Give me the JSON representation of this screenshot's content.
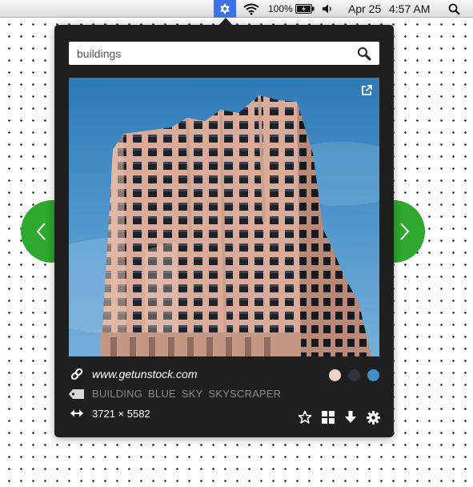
{
  "menubar": {
    "app_icon": "snowflake-gear-icon",
    "wifi_icon": "wifi-icon",
    "battery_percent": "100%",
    "battery_icon": "battery-charging-icon",
    "volume_icon": "speaker-icon",
    "date": "Apr 25",
    "time": "4:57 AM",
    "spotlight_icon": "search-icon"
  },
  "search": {
    "value": "buildings",
    "placeholder": "",
    "button_icon": "search-icon"
  },
  "photo": {
    "subject": "pink-tiled highrise building against blue sky",
    "open_external_icon": "external-link-icon"
  },
  "info": {
    "source_icon": "link-icon",
    "source_url": "www.getunstock.com",
    "tag_icon": "tag-icon",
    "tags": [
      "BUILDING",
      "BLUE",
      "SKY",
      "SKYSCRAPER"
    ],
    "dimensions_icon": "resize-arrows-icon",
    "dimensions": "3721 × 5582",
    "palette": [
      "#ecd3c3",
      "#32323c",
      "#3f8ec7"
    ]
  },
  "toolbar": {
    "favorite_icon": "star-icon",
    "grid_icon": "grid-icon",
    "download_icon": "download-icon",
    "settings_icon": "gear-icon"
  },
  "navigation": {
    "prev_icon": "chevron-left-icon",
    "next_icon": "chevron-right-icon"
  },
  "colors": {
    "accent_green": "#2ea82d",
    "popover_bg": "#1f1f1f",
    "menu_highlight": "#3a73e8"
  }
}
